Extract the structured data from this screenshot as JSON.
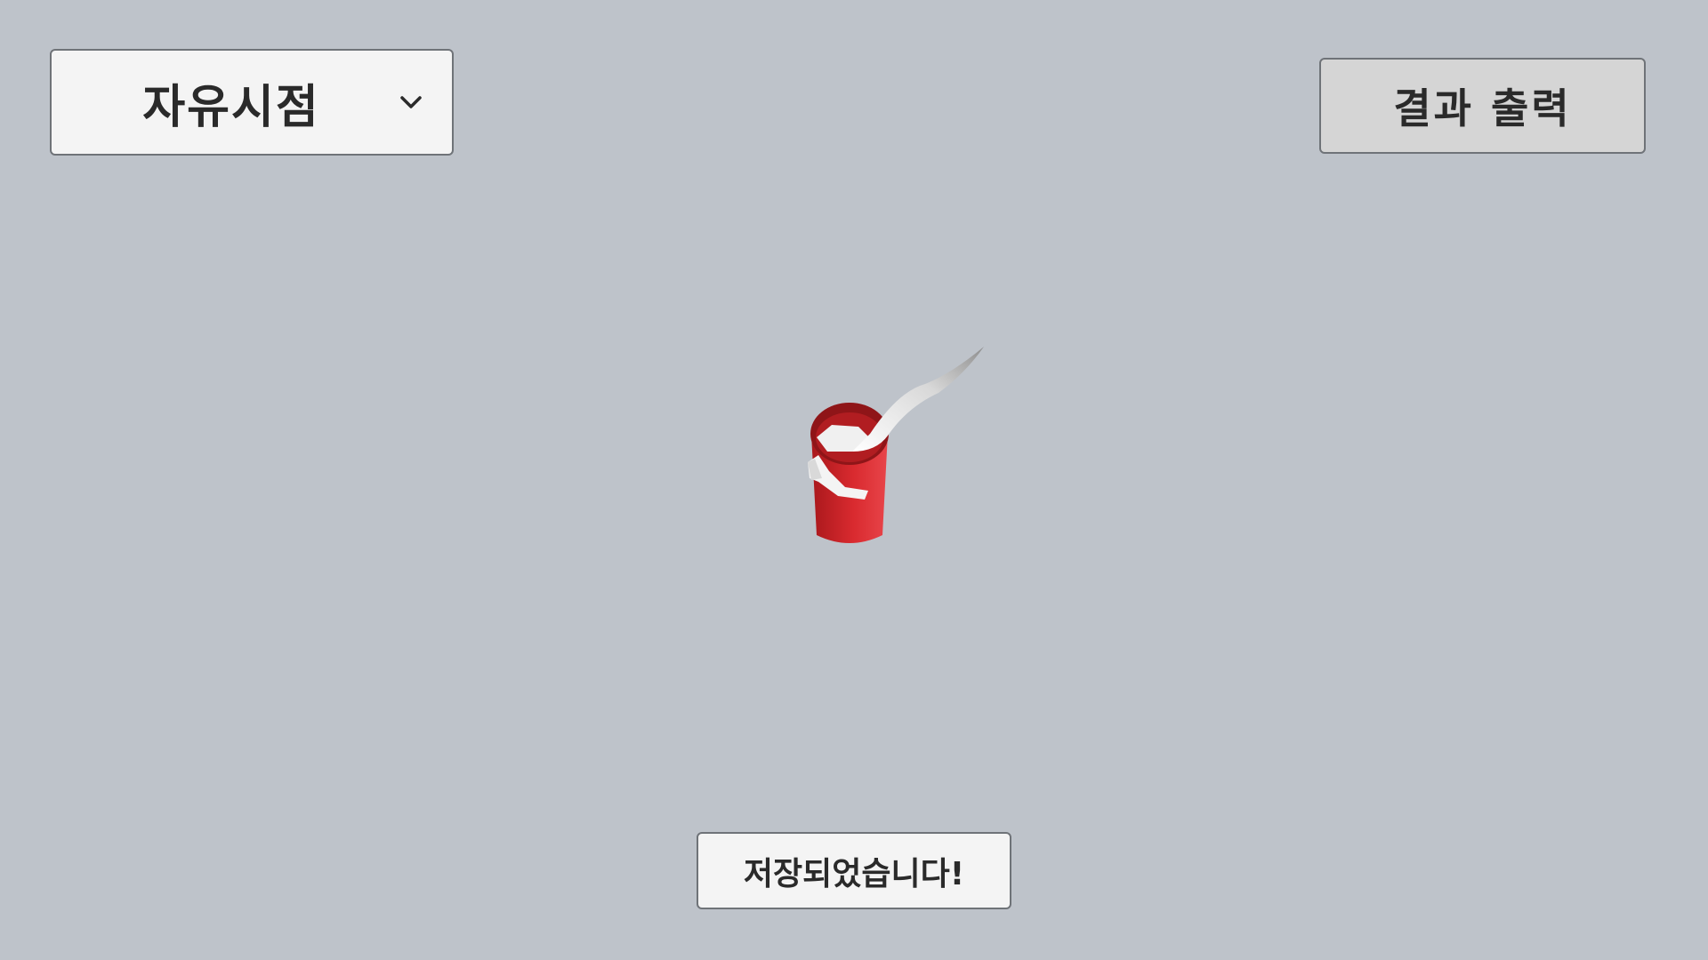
{
  "camera_select": {
    "selected": "자유시점",
    "icon": "chevron-down-icon"
  },
  "result_button": {
    "label": "결과 출력"
  },
  "scene": {
    "object": "red-cup-with-white-ribbon",
    "colors": {
      "background": "#bec3ca",
      "cup": "#d9282d",
      "ribbon": "#f2f2f2"
    }
  },
  "toast": {
    "message": "저장되었습니다!"
  }
}
